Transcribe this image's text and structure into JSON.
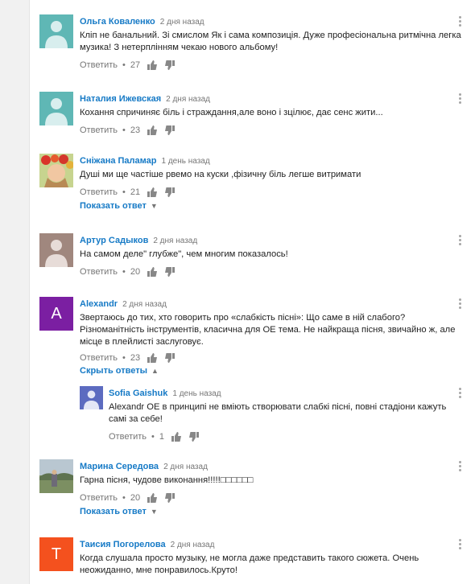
{
  "actions_labels": {
    "reply": "Ответить",
    "dot": "•"
  },
  "comments": [
    {
      "author": "Ольга Коваленко",
      "time": "2 дня назад",
      "text": "Кліп не банальний.  Зі смислом Як і сама композиція. Дуже професіональна ритмічна легка музика! З нетерплінням чекаю нового альбому!",
      "likes": "27",
      "avatar": "default-avatar-icon"
    },
    {
      "author": "Наталия Ижевская",
      "time": "2 дня назад",
      "text": "Кохання спричиняє біль і страждання,але воно і зцілює, дає сенс жити...",
      "likes": "23",
      "avatar": "default-avatar-icon"
    },
    {
      "author": "Сніжана Паламар",
      "time": "1 день назад",
      "text": "Душі ми ще частіше рвемо на куски ,фізичну біль легше витримати",
      "likes": "21",
      "avatar": "photo-avatar-flowers",
      "toggle": "Показать ответ"
    },
    {
      "author": "Артур Садыков",
      "time": "2 дня назад",
      "text": "На самом деле\" глубже\", чем многим показалось!",
      "likes": "20",
      "avatar": "default-avatar-icon"
    },
    {
      "author": "Alexandr",
      "time": "2 дня назад",
      "text": "Звертаюсь до тих, хто говорить про «слабкість пісні»: Що саме в ній слабого? Різноманітність інструментів, класична для ОЕ тема. Не найкраща пісня, звичайно ж, але місце в плейлисті заслуговує.",
      "likes": "23",
      "avatar_letter": "A",
      "avatar_color": "#7b1fa2",
      "toggle": "Скрыть ответы"
    },
    {
      "author": "Sofia Gaishuk",
      "time": "1 день назад",
      "text": "Alexandr ОЕ в принципі не вміють створювати слабкі пісні, повні стадіони кажуть самі за себе!",
      "likes": "1",
      "avatar": "default-avatar-purple",
      "reply": true
    },
    {
      "author": "Марина Середова",
      "time": "2 дня назад",
      "text": "Гарна пісня, чудове виконання!!!!!□□□□□□",
      "likes": "20",
      "avatar": "photo-avatar-landscape",
      "toggle": "Показать ответ"
    },
    {
      "author": "Таисия Погорелова",
      "time": "2 дня назад",
      "text": "Когда слушала просто музыку, не могла даже представить такого сюжета. Очень неожиданно, мне понравилось.Круто!",
      "avatar_letter": "Т",
      "avatar_color": "#f4511e"
    }
  ]
}
